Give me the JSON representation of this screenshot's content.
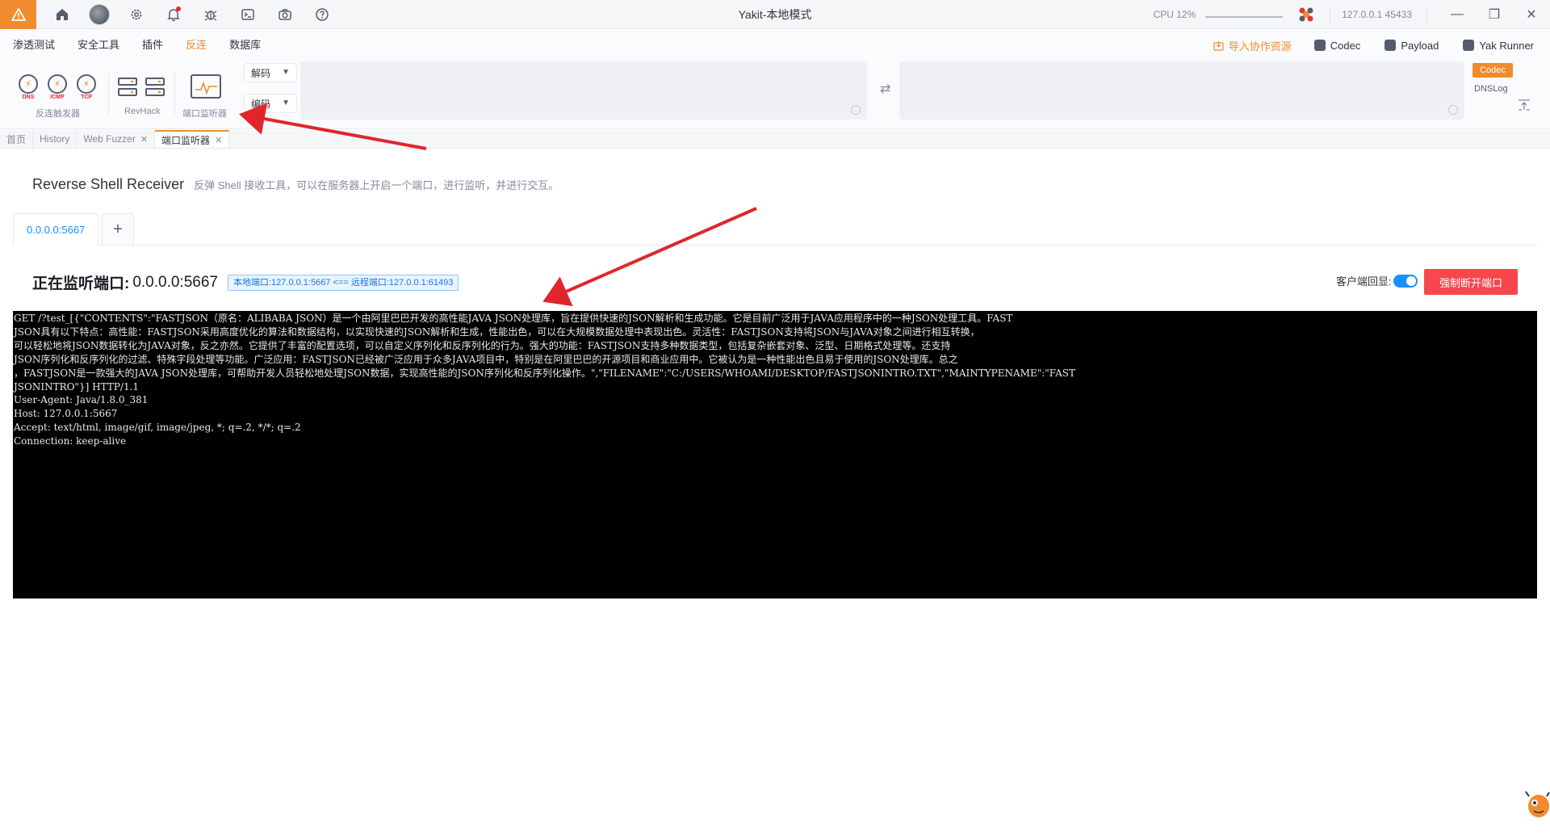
{
  "app": {
    "title": "Yakit-本地模式",
    "cpu": "CPU 12%",
    "address": "127.0.0.1 45433"
  },
  "menu": {
    "items": [
      "渗透测试",
      "安全工具",
      "插件",
      "反连",
      "数据库"
    ],
    "active": "反连",
    "import_label": "导入协作资源",
    "tools": [
      "Codec",
      "Payload",
      "Yak Runner"
    ]
  },
  "ribbon": {
    "triggers": [
      "DNS",
      "ICMP",
      "TCP"
    ],
    "group_reverse_label": "反连触发器",
    "rev_hack_label": "RevHack",
    "listener_label": "端口监听器",
    "decode_label": "解码",
    "encode_label": "编码",
    "codec_pill": "Codec",
    "dnslog": "DNSLog"
  },
  "tabs": [
    {
      "label": "首页",
      "closable": false
    },
    {
      "label": "History",
      "closable": false
    },
    {
      "label": "Web Fuzzer",
      "closable": true
    },
    {
      "label": "端口监听器",
      "closable": true,
      "active": true
    }
  ],
  "page": {
    "title": "Reverse Shell Receiver",
    "description": "反弹 Shell 接收工具，可以在服务器上开启一个端口，进行监听，并进行交互。",
    "conn_tab": "0.0.0.0:5667",
    "add_tab": "+",
    "listening_label": "正在监听端口:",
    "listening_addr": "0.0.0.0:5667",
    "port_tag": "本地端口:127.0.0.1:5667 <== 远程端口:127.0.0.1:61493",
    "echo_label": "客户端回显:",
    "echo_enabled": true,
    "disconnect_label": "强制断开端口"
  },
  "terminal": {
    "lines": [
      "GET /?test_[{\"CONTENTS\":\"FASTJSON（原名：ALIBABA JSON）是一个由阿里巴巴开发的高性能JAVA JSON处理库，旨在提供快速的JSON解析和生成功能。它是目前广泛用于JAVA应用程序中的一种JSON处理工具。FAST",
      "JSON具有以下特点：高性能：FASTJSON采用高度优化的算法和数据结构，以实现快速的JSON解析和生成，性能出色，可以在大规模数据处理中表现出色。灵活性：FASTJSON支持将JSON与JAVA对象之间进行相互转换，",
      "可以轻松地将JSON数据转化为JAVA对象，反之亦然。它提供了丰富的配置选项，可以自定义序列化和反序列化的行为。强大的功能：FASTJSON支持多种数据类型，包括复杂嵌套对象、泛型、日期格式处理等。还支持",
      "JSON序列化和反序列化的过滤、特殊字段处理等功能。广泛应用：FASTJSON已经被广泛应用于众多JAVA项目中，特别是在阿里巴巴的开源项目和商业应用中。它被认为是一种性能出色且易于使用的JSON处理库。总之",
      "，FASTJSON是一款强大的JAVA JSON处理库，可帮助开发人员轻松地处理JSON数据，实现高性能的JSON序列化和反序列化操作。\",\"FILENAME\":\"C:/USERS/WHOAMI/DESKTOP/FASTJSONINTRO.TXT\",\"MAINTYPENAME\":\"FAST",
      "JSONINTRO\"}] HTTP/1.1",
      "User-Agent: Java/1.8.0_381",
      "Host: 127.0.0.1:5667",
      "Accept: text/html, image/gif, image/jpeg, *; q=.2, */*; q=.2",
      "Connection: keep-alive"
    ]
  },
  "colors": {
    "accent": "#f28b2d",
    "primary": "#1890ff",
    "danger": "#f5474c",
    "annotation_arrow": "#e0262b"
  }
}
